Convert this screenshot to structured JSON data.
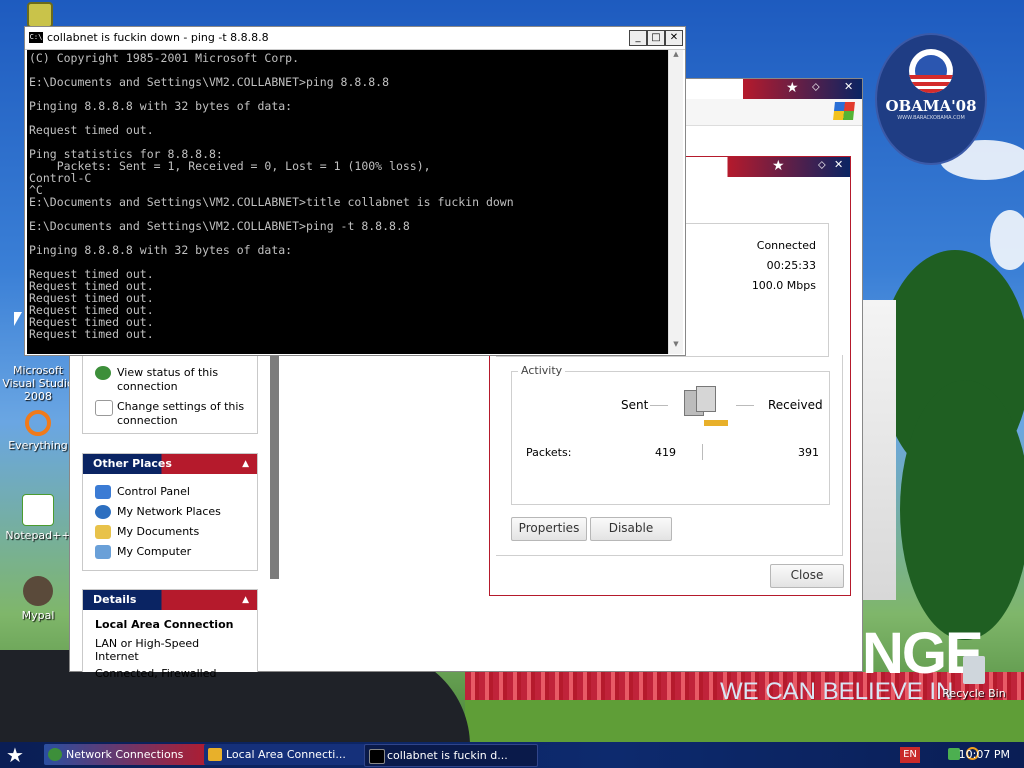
{
  "desktop": {
    "icons": [
      {
        "name": "microsoft-visual-studio-2008",
        "label": "Microsoft Visual Studio 2008"
      },
      {
        "name": "everything",
        "label": "Everything"
      },
      {
        "name": "notepad-plus-plus",
        "label": "Notepad++"
      },
      {
        "name": "mypal",
        "label": "Mypal"
      },
      {
        "name": "recycle-bin",
        "label": "Recycle Bin"
      }
    ],
    "badge": {
      "brand": "OBAMA'08",
      "url": "WWW.BARACKOBAMA.COM"
    },
    "wallpaper_text": {
      "big": "NGE",
      "sub": "WE CAN BELIEVE IN"
    }
  },
  "cmd_window": {
    "title": "collabnet is fuckin down - ping -t 8.8.8.8",
    "icon_label": "C:\\",
    "lines": [
      "(C) Copyright 1985-2001 Microsoft Corp.",
      "",
      "E:\\Documents and Settings\\VM2.COLLABNET>ping 8.8.8.8",
      "",
      "Pinging 8.8.8.8 with 32 bytes of data:",
      "",
      "Request timed out.",
      "",
      "Ping statistics for 8.8.8.8:",
      "    Packets: Sent = 1, Received = 0, Lost = 1 (100% loss),",
      "Control-C",
      "^C",
      "E:\\Documents and Settings\\VM2.COLLABNET>title collabnet is fuckin down",
      "",
      "E:\\Documents and Settings\\VM2.COLLABNET>ping -t 8.8.8.8",
      "",
      "Pinging 8.8.8.8 with 32 bytes of data:",
      "",
      "Request timed out.",
      "Request timed out.",
      "Request timed out.",
      "Request timed out.",
      "Request timed out.",
      "Request timed out."
    ]
  },
  "network_window": {
    "tasks": [
      {
        "icon": "globe-icon",
        "label": "View status of this connection"
      },
      {
        "icon": "settings-icon",
        "label": "Change settings of this connection"
      }
    ],
    "other_places": {
      "heading": "Other Places",
      "items": [
        "Control Panel",
        "My Network Places",
        "My Documents",
        "My Computer"
      ]
    },
    "details": {
      "heading": "Details",
      "title": "Local Area Connection",
      "line1": "LAN or High-Speed Internet",
      "line2": "Connected, Firewalled"
    }
  },
  "lan_status": {
    "connection": {
      "status": "Connected",
      "duration": "00:25:33",
      "speed": "100.0 Mbps"
    },
    "activity": {
      "legend": "Activity",
      "sent_label": "Sent",
      "received_label": "Received",
      "packets_label": "Packets:",
      "sent_packets": "419",
      "received_packets": "391"
    },
    "buttons": {
      "properties": "Properties",
      "disable": "Disable",
      "close": "Close"
    }
  },
  "taskbar": {
    "tabs": [
      {
        "label": "Network Connections"
      },
      {
        "label": "Local Area Connecti..."
      },
      {
        "label": "collabnet is fuckin d..."
      }
    ],
    "language": "EN",
    "time": "10:07 PM"
  }
}
